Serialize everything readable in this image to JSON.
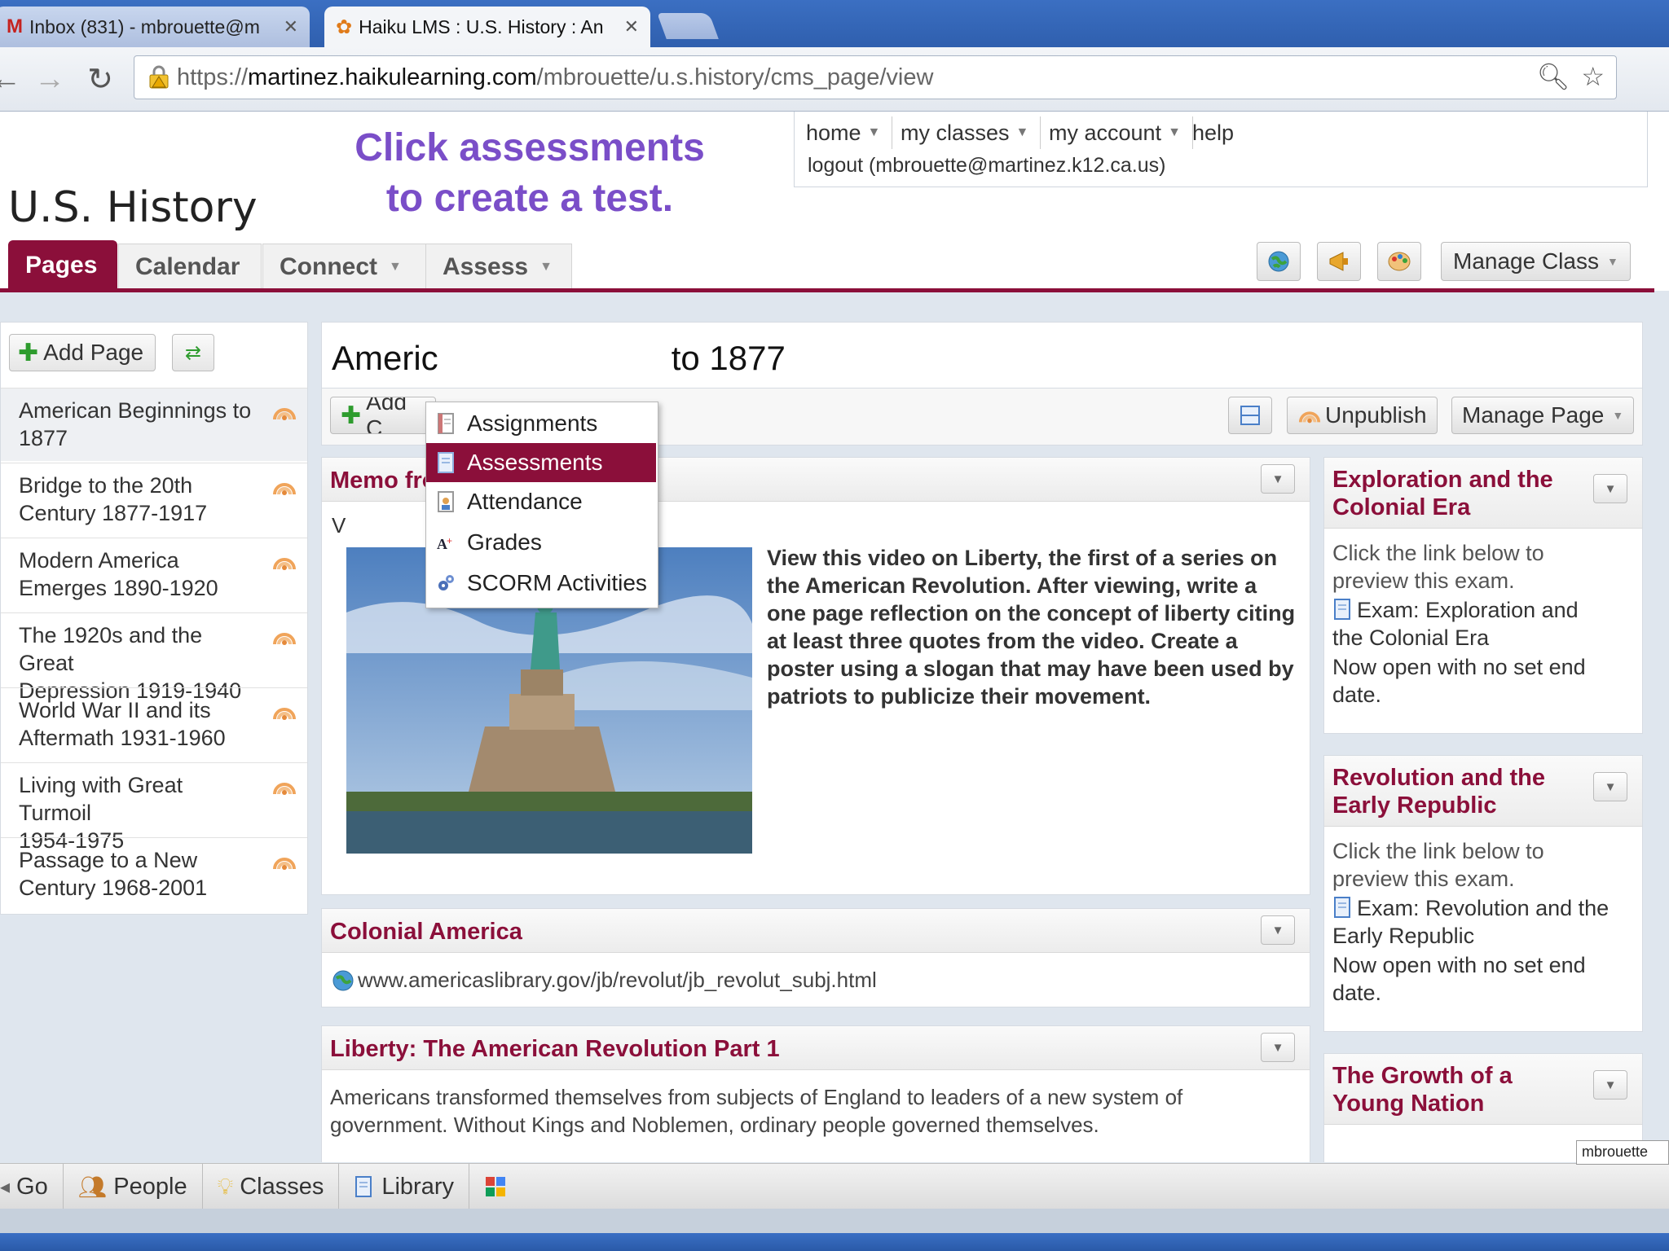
{
  "browser": {
    "tabs": [
      {
        "title": "Inbox (831) - mbrouette@m",
        "icon": "gmail-icon"
      },
      {
        "title": "Haiku LMS : U.S. History : An",
        "icon": "haiku-icon"
      }
    ],
    "url": {
      "scheme": "https://",
      "host": "martinez.haikulearning.com",
      "path": "/mbrouette/u.s.history/cms_page/view"
    }
  },
  "header": {
    "site_title": "U.S. History",
    "callout_line1": "Click assessments",
    "callout_line2": "to create a test.",
    "topnav": [
      "home",
      "my classes",
      "my account",
      "help"
    ],
    "logout": "logout (mbrouette@martinez.k12.ca.us)",
    "manage_class": "Manage Class"
  },
  "tabs": [
    "Pages",
    "Calendar",
    "Connect",
    "Assess"
  ],
  "assess_menu": [
    "Assignments",
    "Assessments",
    "Attendance",
    "Grades",
    "SCORM Activities"
  ],
  "sidebar": {
    "add_page": "Add Page",
    "items": [
      {
        "line1": "American Beginnings to",
        "line2": "1877"
      },
      {
        "line1": "Bridge to the 20th",
        "line2": "Century 1877-1917"
      },
      {
        "line1": "Modern America",
        "line2": "Emerges 1890-1920"
      },
      {
        "line1": "The 1920s and the Great",
        "line2": "Depression 1919-1940"
      },
      {
        "line1": "World War II and its",
        "line2": "Aftermath 1931-1960"
      },
      {
        "line1": "Living with Great Turmoil",
        "line2": "1954-1975"
      },
      {
        "line1": "Passage to a New",
        "line2": "Century 1968-2001"
      }
    ]
  },
  "main": {
    "heading_left": "Americ",
    "heading_right": "to 1877",
    "add_content": "Add C",
    "unpublish": "Unpublish",
    "manage_page": "Manage Page",
    "memo": {
      "title": "Memo from Marilyn",
      "v": "V",
      "text": "View this video on Liberty, the first of a series on the American Revolution.  After viewing, write a one page reflection on the concept of liberty citing at least three quotes from the video.  Create a poster using a slogan that may have been used by patriots to publicize their movement."
    },
    "colonial": {
      "title": "Colonial America",
      "link": "www.americaslibrary.gov/jb/revolut/jb_revolut_subj.html"
    },
    "liberty": {
      "title": "Liberty: The American Revolution Part 1",
      "line1": "Americans transformed themselves from subjects of England to leaders of a new system of",
      "line2": "government.  Without Kings and Noblemen, ordinary people governed themselves."
    }
  },
  "right_panels": [
    {
      "title1": "Exploration and the",
      "title2": "Colonial Era",
      "intro1": "Click the link below to",
      "intro2": "preview this exam.",
      "exam1": "Exam: Exploration and",
      "exam2": "the Colonial Era",
      "status1": "Now open with no set end",
      "status2": "date."
    },
    {
      "title1": "Revolution and the",
      "title2": "Early Republic",
      "intro1": "Click the link below to",
      "intro2": "preview this exam.",
      "exam1": "Exam: Revolution and the",
      "exam2": "Early Republic",
      "status1": "Now open with no set end",
      "status2": "date."
    },
    {
      "title1": "The Growth of a",
      "title2": "Young Nation"
    }
  ],
  "bottombar": {
    "go": "Go",
    "people": "People",
    "classes": "Classes",
    "library": "Library",
    "tooltip": "mbrouette"
  },
  "colors": {
    "accent": "#8b0f3a",
    "callout": "#7a4ec8"
  }
}
